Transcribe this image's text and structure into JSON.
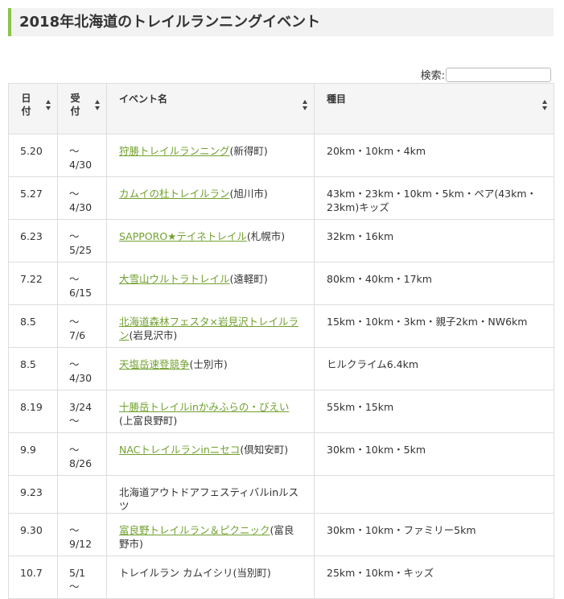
{
  "page": {
    "title": "2018年北海道のトレイルランニングイベント"
  },
  "search": {
    "label": "検索:",
    "value": "",
    "placeholder": ""
  },
  "table": {
    "headers": {
      "date": "日付",
      "reception": "受付",
      "event": "イベント名",
      "category": "種目"
    },
    "rows": [
      {
        "date": "5.20",
        "reception": "〜\n4/30",
        "event_link": "狩勝トレイルランニング",
        "event_suffix": "(新得町)",
        "category": "20km・10km・4km"
      },
      {
        "date": "5.27",
        "reception": "〜\n4/30",
        "event_link": "カムイの杜トレイルラン",
        "event_suffix": "(旭川市)",
        "category": "43km・23km・10km・5km・ペア(43km・23km)キッズ"
      },
      {
        "date": "6.23",
        "reception": "〜\n5/25",
        "event_link": "SAPPORO★テイネトレイル",
        "event_suffix": "(札幌市)",
        "category": "32km・16km"
      },
      {
        "date": "7.22",
        "reception": "〜\n6/15",
        "event_link": "大雪山ウルトラトレイル",
        "event_suffix": "(遠軽町)",
        "category": "80km・40km・17km"
      },
      {
        "date": "8.5",
        "reception": "〜\n7/6",
        "event_link": "北海道森林フェスタ×岩見沢トレイルラン",
        "event_suffix": "(岩見沢市)",
        "category": "15km・10km・3km・親子2km・NW6km"
      },
      {
        "date": "8.5",
        "reception": "〜\n4/30",
        "event_link": "天塩岳速登競争",
        "event_suffix": "(士別市)",
        "category": "ヒルクライム6.4km"
      },
      {
        "date": "8.19",
        "reception": "3/24\n〜",
        "event_link": "十勝岳トレイルinかみふらの・びえい",
        "event_suffix": "(上富良野町)",
        "category": "55km・15km"
      },
      {
        "date": "9.9",
        "reception": "〜\n8/26",
        "event_link": "NACトレイルランinニセコ",
        "event_suffix": "(倶知安町)",
        "category": "30km・10km・5km"
      },
      {
        "date": "9.23",
        "reception": "",
        "event_link": "",
        "event_suffix": "北海道アウトドアフェスティバルinルスツ",
        "category": ""
      },
      {
        "date": "9.30",
        "reception": "〜\n9/12",
        "event_link": "富良野トレイルラン＆ピクニック",
        "event_suffix": "(富良野市)",
        "category": "30km・10km・ファミリー5km"
      },
      {
        "date": "10.7",
        "reception": "5/1\n〜",
        "event_link": "",
        "event_suffix": "トレイルラン カムイシリ(当別町)",
        "category": "25km・10km・キッズ"
      }
    ]
  }
}
